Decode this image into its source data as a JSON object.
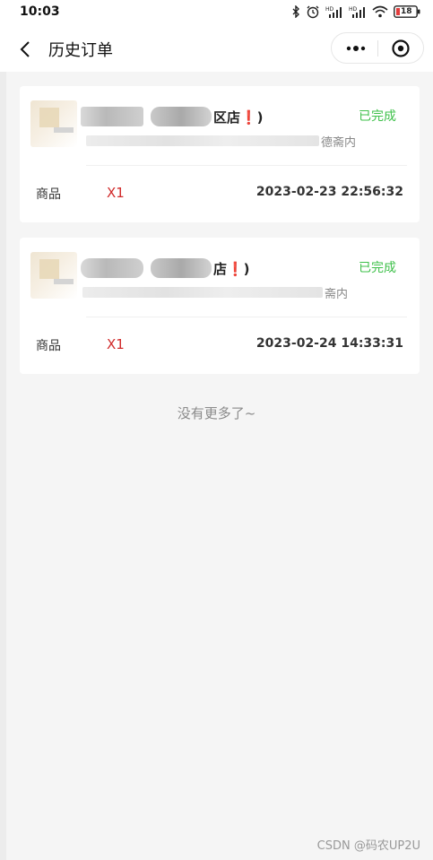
{
  "status_bar": {
    "time": "10:03",
    "battery": "18",
    "icons": [
      "bluetooth-icon",
      "alarm-icon",
      "signal-hd-icon",
      "signal-hd-icon",
      "wifi-icon",
      "battery-icon"
    ]
  },
  "nav": {
    "title": "历史订单",
    "back_icon": "chevron-left-icon",
    "more_icon": "more-dots-icon",
    "target_icon": "target-icon"
  },
  "orders": [
    {
      "shop_suffix": "区店❗)",
      "address_suffix": "德斋内",
      "status": "已完成",
      "goods_label": "商品",
      "quantity": "X1",
      "time": "2023-02-23 22:56:32"
    },
    {
      "shop_suffix": "店❗)",
      "address_suffix": "斋内",
      "status": "已完成",
      "goods_label": "商品",
      "quantity": "X1",
      "time": "2023-02-24 14:33:31"
    }
  ],
  "footer": {
    "no_more": "没有更多了~"
  },
  "watermark": "CSDN @码农UP2U",
  "colors": {
    "status_done": "#3ec04a",
    "quantity": "#d12b2b"
  }
}
